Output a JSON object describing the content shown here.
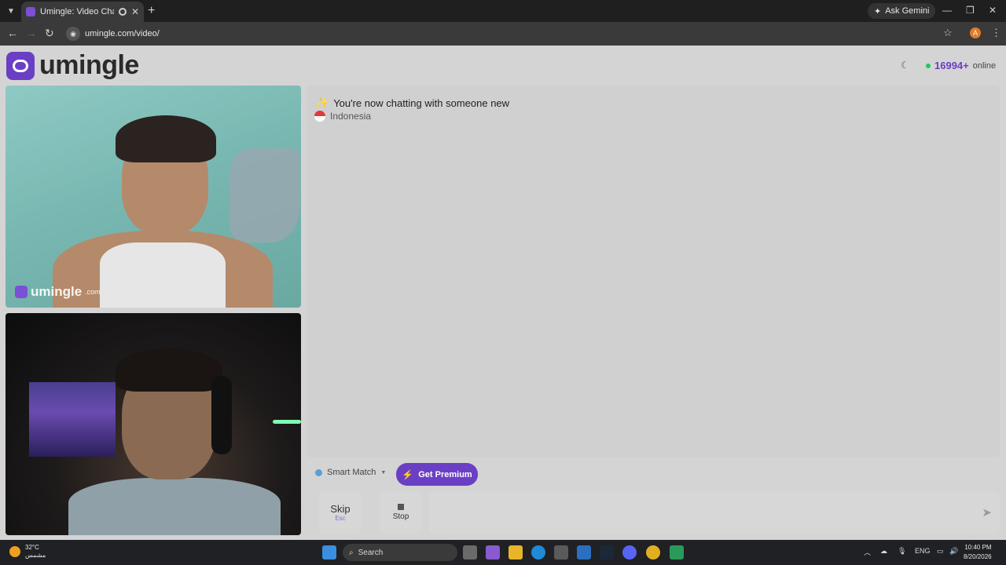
{
  "browser": {
    "tab_title": "Umingle: Video Chat with S",
    "url": "umingle.com/video/",
    "ask_gemini": "Ask Gemini",
    "profile_initial": "A"
  },
  "site": {
    "logo_text": "umingle",
    "online_count": "16994+",
    "online_label": "online",
    "watermark_text": "umingle",
    "watermark_suffix": ".com"
  },
  "chat": {
    "status_message": "You're now chatting with someone new",
    "country": "Indonesia"
  },
  "controls": {
    "match_mode": "Smart Match",
    "premium_label": "Get Premium",
    "skip_label": "Skip",
    "skip_key": "Esc",
    "stop_label": "Stop"
  },
  "taskbar": {
    "temperature": "32°C",
    "weather_desc": "مشمس",
    "search_placeholder": "Search",
    "language": "ENG",
    "time": "10:40 PM",
    "date": "8/20/2026"
  },
  "colors": {
    "brand": "#6b3fc4",
    "online_dot": "#22c55e"
  }
}
